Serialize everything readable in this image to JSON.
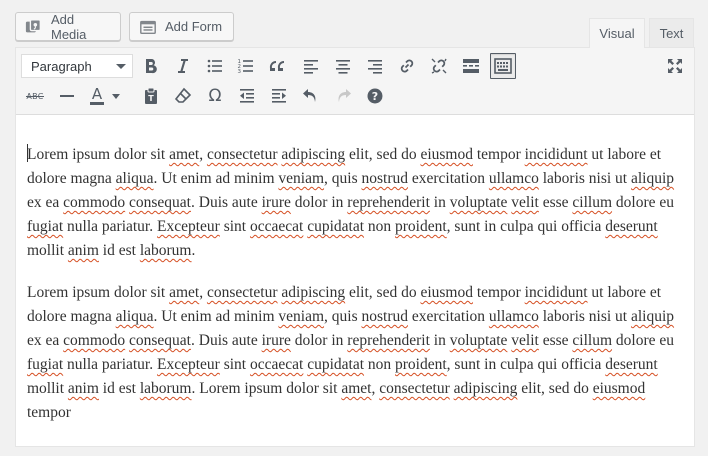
{
  "media_buttons": {
    "add_media": "Add Media",
    "add_form": "Add Form"
  },
  "tabs": {
    "visual": "Visual",
    "text": "Text",
    "active": "Visual"
  },
  "toolbar": {
    "format_select": "Paragraph",
    "row1": [
      "bold-icon",
      "italic-icon",
      "bulleted-list-icon",
      "numbered-list-icon",
      "blockquote-icon",
      "align-left-icon",
      "align-center-icon",
      "align-right-icon",
      "insert-link-icon",
      "remove-link-icon",
      "read-more-icon",
      "toolbar-toggle-icon",
      "fullscreen-icon"
    ],
    "row2": [
      "strikethrough-icon",
      "horizontal-line-icon",
      "text-color-icon",
      "paste-as-text-icon",
      "clear-formatting-icon",
      "special-character-icon",
      "outdent-icon",
      "indent-icon",
      "undo-icon",
      "redo-icon",
      "help-icon"
    ],
    "strikethrough_label": "ABC",
    "text_color_label": "A",
    "special_char_label": "Ω",
    "text_color_value": "#555d66"
  },
  "content": {
    "paragraphs": [
      [
        {
          "t": "Lorem ipsum dolor sit "
        },
        {
          "t": "amet",
          "s": 1
        },
        {
          "t": ", "
        },
        {
          "t": "consectetur",
          "s": 1
        },
        {
          "t": " "
        },
        {
          "t": "adipiscing",
          "s": 1
        },
        {
          "t": " elit, sed do "
        },
        {
          "t": "eiusmod",
          "s": 1
        },
        {
          "t": " tempor "
        },
        {
          "t": "incididunt",
          "s": 1
        },
        {
          "t": " ut labore et dolore magna "
        },
        {
          "t": "aliqua",
          "s": 1
        },
        {
          "t": ". Ut enim ad minim "
        },
        {
          "t": "veniam",
          "s": 1
        },
        {
          "t": ", quis "
        },
        {
          "t": "nostrud",
          "s": 1
        },
        {
          "t": " exercitation "
        },
        {
          "t": "ullamco",
          "s": 1
        },
        {
          "t": " laboris nisi ut "
        },
        {
          "t": "aliquip",
          "s": 1
        },
        {
          "t": " ex ea "
        },
        {
          "t": "commodo",
          "s": 1
        },
        {
          "t": " "
        },
        {
          "t": "consequat",
          "s": 1
        },
        {
          "t": ". Duis aute "
        },
        {
          "t": "irure",
          "s": 1
        },
        {
          "t": " dolor in "
        },
        {
          "t": "reprehenderit",
          "s": 1
        },
        {
          "t": " in "
        },
        {
          "t": "voluptate",
          "s": 1
        },
        {
          "t": " "
        },
        {
          "t": "velit",
          "s": 1
        },
        {
          "t": " esse "
        },
        {
          "t": "cillum",
          "s": 1
        },
        {
          "t": " dolore eu "
        },
        {
          "t": "fugiat",
          "s": 1
        },
        {
          "t": " nulla pariatur. "
        },
        {
          "t": "Excepteur",
          "s": 1
        },
        {
          "t": " sint "
        },
        {
          "t": "occaecat",
          "s": 1
        },
        {
          "t": " "
        },
        {
          "t": "cupidatat",
          "s": 1
        },
        {
          "t": " non "
        },
        {
          "t": "proident",
          "s": 1
        },
        {
          "t": ", sunt in culpa qui officia "
        },
        {
          "t": "deserunt",
          "s": 1
        },
        {
          "t": " mollit "
        },
        {
          "t": "anim",
          "s": 1
        },
        {
          "t": " id est "
        },
        {
          "t": "laborum",
          "s": 1
        },
        {
          "t": "."
        }
      ],
      [
        {
          "t": "Lorem ipsum dolor sit "
        },
        {
          "t": "amet",
          "s": 1
        },
        {
          "t": ", "
        },
        {
          "t": "consectetur",
          "s": 1
        },
        {
          "t": " "
        },
        {
          "t": "adipiscing",
          "s": 1
        },
        {
          "t": " elit, sed do "
        },
        {
          "t": "eiusmod",
          "s": 1
        },
        {
          "t": " tempor "
        },
        {
          "t": "incididunt",
          "s": 1
        },
        {
          "t": " ut labore et dolore magna "
        },
        {
          "t": "aliqua",
          "s": 1
        },
        {
          "t": ". Ut enim ad minim "
        },
        {
          "t": "veniam",
          "s": 1
        },
        {
          "t": ", quis "
        },
        {
          "t": "nostrud",
          "s": 1
        },
        {
          "t": " exercitation "
        },
        {
          "t": "ullamco",
          "s": 1
        },
        {
          "t": " laboris nisi ut "
        },
        {
          "t": "aliquip",
          "s": 1
        },
        {
          "t": " ex ea "
        },
        {
          "t": "commodo",
          "s": 1
        },
        {
          "t": " "
        },
        {
          "t": "consequat",
          "s": 1
        },
        {
          "t": ". Duis aute "
        },
        {
          "t": "irure",
          "s": 1
        },
        {
          "t": " dolor in "
        },
        {
          "t": "reprehenderit",
          "s": 1
        },
        {
          "t": " in "
        },
        {
          "t": "voluptate",
          "s": 1
        },
        {
          "t": " "
        },
        {
          "t": "velit",
          "s": 1
        },
        {
          "t": " esse "
        },
        {
          "t": "cillum",
          "s": 1
        },
        {
          "t": " dolore eu "
        },
        {
          "t": "fugiat",
          "s": 1
        },
        {
          "t": " nulla pariatur. "
        },
        {
          "t": "Excepteur",
          "s": 1
        },
        {
          "t": " sint "
        },
        {
          "t": "occaecat",
          "s": 1
        },
        {
          "t": " "
        },
        {
          "t": "cupidatat",
          "s": 1
        },
        {
          "t": " non "
        },
        {
          "t": "proident",
          "s": 1
        },
        {
          "t": ", sunt in culpa qui officia "
        },
        {
          "t": "deserunt",
          "s": 1
        },
        {
          "t": " mollit "
        },
        {
          "t": "anim",
          "s": 1
        },
        {
          "t": " id est "
        },
        {
          "t": "laborum",
          "s": 1
        },
        {
          "t": ". Lorem ipsum dolor sit "
        },
        {
          "t": "amet",
          "s": 1
        },
        {
          "t": ", "
        },
        {
          "t": "consectetur",
          "s": 1
        },
        {
          "t": " "
        },
        {
          "t": "adipiscing",
          "s": 1
        },
        {
          "t": " elit, sed do "
        },
        {
          "t": "eiusmod",
          "s": 1
        },
        {
          "t": " tempor"
        }
      ]
    ]
  },
  "colors": {
    "spellcheck_underline": "#d54e21",
    "toolbar_bg": "#f5f5f5",
    "icon": "#555d66"
  }
}
